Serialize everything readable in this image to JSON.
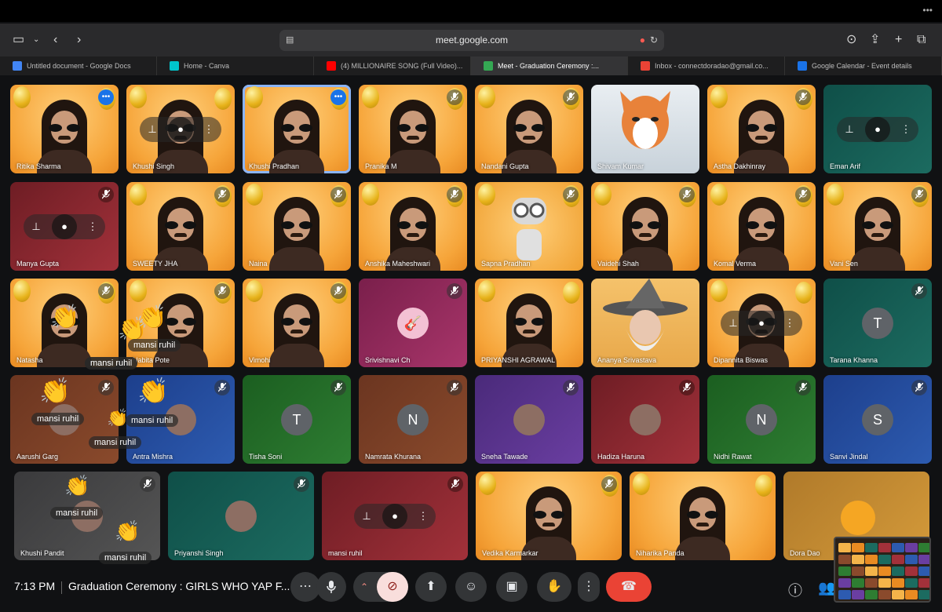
{
  "browser": {
    "url": "meet.google.com",
    "tabs": [
      {
        "label": "Untitled document - Google Docs",
        "color": "#4285f4",
        "active": false
      },
      {
        "label": "Home - Canva",
        "color": "#00c4cc",
        "active": false
      },
      {
        "label": "(4) MILLIONAIRE SONG (Full Video)...",
        "color": "#ff0000",
        "active": false
      },
      {
        "label": "Meet - Graduation Ceremony :...",
        "color": "#34a853",
        "active": true
      },
      {
        "label": "Inbox - connectdoradao@gmail.co...",
        "color": "#ea4335",
        "active": false
      },
      {
        "label": "Google Calendar - Event details",
        "color": "#1a73e8",
        "active": false
      }
    ]
  },
  "participants": [
    {
      "name": "Ritika Sharma",
      "kind": "banner",
      "status": "speaking"
    },
    {
      "name": "Khushi Singh",
      "kind": "banner",
      "status": "hover"
    },
    {
      "name": "Khushi Pradhan",
      "kind": "banner",
      "status": "speaking-outline"
    },
    {
      "name": "Pranika M",
      "kind": "banner",
      "status": "muted"
    },
    {
      "name": "Nandani Gupta",
      "kind": "banner",
      "status": "muted"
    },
    {
      "name": "Shivam Kumar",
      "kind": "cat",
      "status": "none"
    },
    {
      "name": "Astha Dakhinray",
      "kind": "banner",
      "status": "muted"
    },
    {
      "name": "Eman Arif",
      "kind": "teal",
      "status": "hover"
    },
    {
      "name": "Manya Gupta",
      "kind": "red",
      "status": "hover-muted"
    },
    {
      "name": "SWEETY JHA",
      "kind": "banner",
      "status": "muted"
    },
    {
      "name": "Naina",
      "kind": "banner",
      "status": "muted"
    },
    {
      "name": "Anshika Maheshwari",
      "kind": "banner",
      "status": "muted"
    },
    {
      "name": "Sapna Pradhan",
      "kind": "robot",
      "status": "muted"
    },
    {
      "name": "Vaidehi Shah",
      "kind": "banner",
      "status": "muted"
    },
    {
      "name": "Komal Verma",
      "kind": "banner",
      "status": "muted"
    },
    {
      "name": "Vani Sen",
      "kind": "banner",
      "status": "muted"
    },
    {
      "name": "Natasha",
      "kind": "banner",
      "status": "muted"
    },
    {
      "name": "Nabita Pote",
      "kind": "banner",
      "status": "muted"
    },
    {
      "name": "Vimohi",
      "kind": "banner",
      "status": "muted"
    },
    {
      "name": "Srivishnavi Ch",
      "kind": "avatar-pink",
      "status": "muted"
    },
    {
      "name": "PRIYANSHI AGRAWAL",
      "kind": "banner",
      "status": "none"
    },
    {
      "name": "Ananya Srivastava",
      "kind": "wizard",
      "status": "none"
    },
    {
      "name": "Dipannita Biswas",
      "kind": "banner",
      "status": "hover"
    },
    {
      "name": "Tarana Khanna",
      "kind": "teal",
      "initial": "T",
      "status": "muted"
    },
    {
      "name": "Aarushi Garg",
      "kind": "brown",
      "status": "muted"
    },
    {
      "name": "Antra Mishra",
      "kind": "blue",
      "status": "muted"
    },
    {
      "name": "Tisha Soni",
      "kind": "green",
      "initial": "T",
      "status": "muted"
    },
    {
      "name": "Namrata Khurana",
      "kind": "brown",
      "initial": "N",
      "status": "muted"
    },
    {
      "name": "Sneha Tawade",
      "kind": "purple",
      "status": "muted"
    },
    {
      "name": "Hadiza Haruna",
      "kind": "red",
      "status": "muted"
    },
    {
      "name": "Nidhi Rawat",
      "kind": "green",
      "initial": "N",
      "status": "muted"
    },
    {
      "name": "Sanvi Jindal",
      "kind": "blue",
      "initial": "S",
      "status": "muted"
    },
    {
      "name": "Khushi Pandit",
      "kind": "grey",
      "status": "muted"
    },
    {
      "name": "Priyanshi Singh",
      "kind": "teal",
      "status": "muted"
    },
    {
      "name": "mansi ruhil",
      "kind": "red",
      "status": "hover-muted"
    },
    {
      "name": "Vedika Karmarkar",
      "kind": "banner",
      "status": "muted"
    },
    {
      "name": "Niharika Panda",
      "kind": "banner",
      "status": "none"
    },
    {
      "name": "Dora Dao",
      "kind": "gold",
      "status": "none"
    }
  ],
  "reaction_label": "mansi ruhil",
  "bottom": {
    "time": "7:13 PM",
    "meeting_title": "Graduation Ceremony : GIRLS WHO YAP F..."
  },
  "icons": [
    "sidebar-icon",
    "back-icon",
    "forward-icon",
    "download-icon",
    "share-icon",
    "new-tab-icon",
    "tabs-overview-icon",
    "mic-icon",
    "more-icon",
    "camera-off-icon",
    "present-icon",
    "emoji-icon",
    "captions-icon",
    "raise-hand-icon",
    "end-call-icon",
    "info-icon",
    "people-icon"
  ],
  "colors": {
    "accent": "#8ab4f8",
    "end_call": "#ea4335",
    "camera_off": "#f9dedc"
  }
}
